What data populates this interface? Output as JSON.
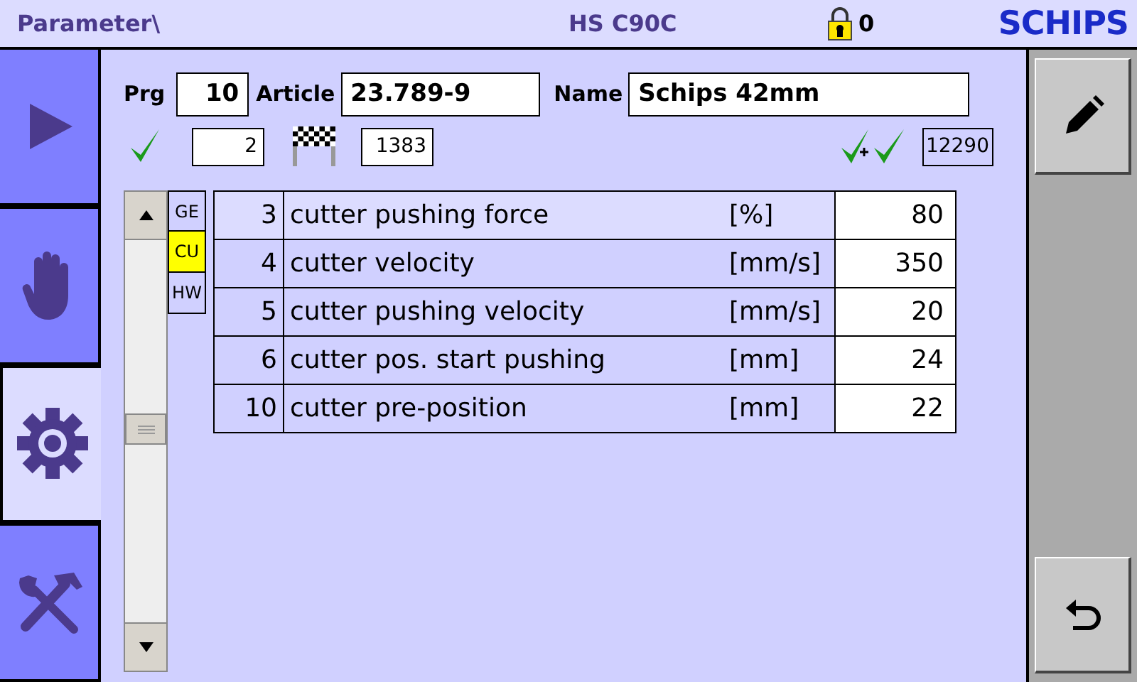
{
  "header": {
    "title": "Parameter\\",
    "machine": "HS C90C",
    "lock_count": "0",
    "logo": "SCHIPS"
  },
  "nav": [
    {
      "kind": "play",
      "selected": false
    },
    {
      "kind": "hand",
      "selected": false
    },
    {
      "kind": "gear",
      "selected": true
    },
    {
      "kind": "tools",
      "selected": false
    }
  ],
  "program": {
    "prg_label": "Prg",
    "prg": "10",
    "article_label": "Article",
    "article": "23.789-9",
    "name_label": "Name",
    "name": "Schips 42mm"
  },
  "counters": [
    {
      "kind": "check",
      "value": "2"
    },
    {
      "kind": "flag",
      "value": "1383"
    },
    {
      "kind": "total",
      "value": "12290"
    }
  ],
  "sections": [
    {
      "label": "GE",
      "selected": false
    },
    {
      "label": "CU",
      "selected": true
    },
    {
      "label": "HW",
      "selected": false
    }
  ],
  "params": [
    {
      "number": "3",
      "name": "cutter pushing force",
      "unit": "[%]",
      "value": "80",
      "selected": true
    },
    {
      "number": "4",
      "name": "cutter velocity",
      "unit": "[mm/s]",
      "value": "350",
      "selected": false
    },
    {
      "number": "5",
      "name": "cutter pushing velocity",
      "unit": "[mm/s]",
      "value": "20",
      "selected": false
    },
    {
      "number": "6",
      "name": "cutter pos. start pushing",
      "unit": "[mm]",
      "value": "24",
      "selected": false
    },
    {
      "number": "10",
      "name": "cutter pre-position",
      "unit": "[mm]",
      "value": "22",
      "selected": false
    }
  ],
  "actions": [
    {
      "kind": "edit"
    },
    {
      "kind": "back"
    }
  ]
}
